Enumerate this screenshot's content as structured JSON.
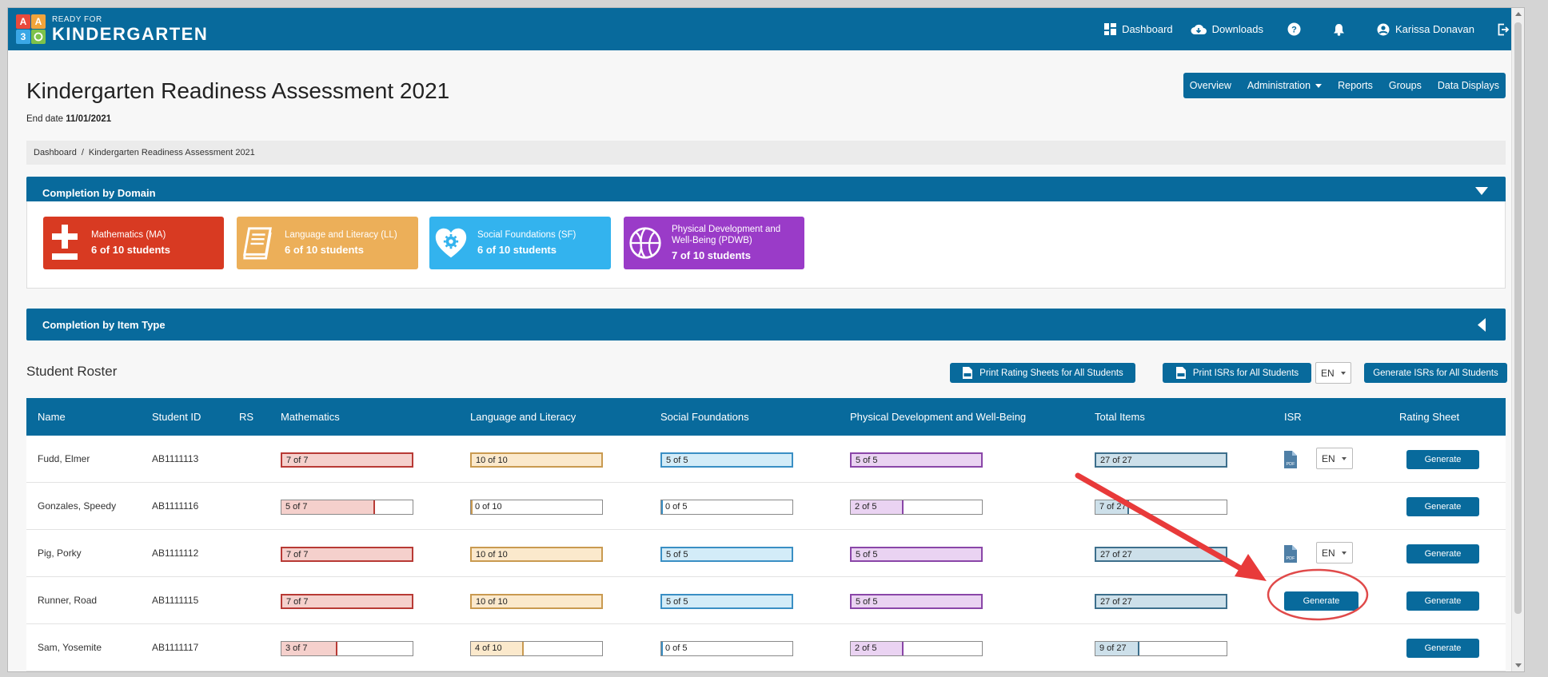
{
  "app": {
    "logo_small": "READY FOR",
    "logo_big": "KINDERGARTEN",
    "logo_blocks": [
      "A",
      "A",
      "3",
      ""
    ]
  },
  "topnav": {
    "dashboard": "Dashboard",
    "downloads": "Downloads",
    "user": "Karissa Donavan"
  },
  "page": {
    "title": "Kindergarten Readiness Assessment 2021",
    "end_date_label": "End date",
    "end_date_value": "11/01/2021"
  },
  "subnav": {
    "items": [
      "Overview",
      "Administration",
      "Reports",
      "Groups",
      "Data Displays"
    ]
  },
  "breadcrumb": {
    "items": [
      "Dashboard",
      "/",
      "Kindergarten Readiness Assessment 2021"
    ]
  },
  "sections": {
    "domain_title": "Completion by Domain",
    "item_type_title": "Completion by Item Type"
  },
  "domains": [
    {
      "name": "Mathematics (MA)",
      "count": "6 of 10 students",
      "color": "#d83a22",
      "icon": "plus-minus-icon"
    },
    {
      "name": "Language and Literacy (LL)",
      "count": "6 of 10 students",
      "color": "#ecaf59",
      "icon": "book-icon"
    },
    {
      "name": "Social Foundations (SF)",
      "count": "6 of 10 students",
      "color": "#33b3ee",
      "icon": "heart-gear-icon"
    },
    {
      "name": "Physical Development and Well-Being (PDWB)",
      "name_line1": "Physical Development and",
      "name_line2": "Well-Being (PDWB)",
      "count": "7 of 10 students",
      "color": "#9a3bc8",
      "icon": "ball-icon"
    }
  ],
  "roster": {
    "title": "Student Roster",
    "print_rating_sheets": "Print Rating Sheets for All Students",
    "print_isrs": "Print ISRs for All Students",
    "language": "EN",
    "generate_isrs": "Generate ISRs for All Students"
  },
  "table": {
    "headers": [
      "Name",
      "Student ID",
      "RS",
      "Mathematics",
      "Language and Literacy",
      "Social Foundations",
      "Physical Development and Well-Being",
      "Total Items",
      "ISR",
      "Rating Sheet"
    ],
    "generate_label": "Generate",
    "lang_label": "EN",
    "colors": {
      "math_fill": "#f5d0cc",
      "math_border": "#b83a35",
      "ll_fill": "#fbe9cc",
      "ll_border": "#c99a50",
      "sf_fill": "#d3ecf8",
      "sf_border": "#3a8fc4",
      "pd_fill": "#ead3f2",
      "pd_border": "#8a46a8",
      "total_fill": "#cde0ea",
      "total_border": "#3d6f8c"
    },
    "rows": [
      {
        "name": "Fudd, Elmer",
        "id": "AB1111113",
        "rs": "",
        "math": "7 of 7",
        "math_frac": 1.0,
        "ll": "10 of 10",
        "ll_frac": 1.0,
        "sf": "5 of 5",
        "sf_frac": 1.0,
        "pd": "5 of 5",
        "pd_frac": 1.0,
        "total": "27 of 27",
        "total_frac": 1.0,
        "isr": "pdf"
      },
      {
        "name": "Gonzales, Speedy",
        "id": "AB1111116",
        "rs": "",
        "math": "5 of 7",
        "math_frac": 0.714,
        "ll": "0 of 10",
        "ll_frac": 0.0,
        "sf": "0 of 5",
        "sf_frac": 0.0,
        "pd": "2 of 5",
        "pd_frac": 0.4,
        "total": "7 of 27",
        "total_frac": 0.259,
        "isr": "none"
      },
      {
        "name": "Pig, Porky",
        "id": "AB1111112",
        "rs": "",
        "math": "7 of 7",
        "math_frac": 1.0,
        "ll": "10 of 10",
        "ll_frac": 1.0,
        "sf": "5 of 5",
        "sf_frac": 1.0,
        "pd": "5 of 5",
        "pd_frac": 1.0,
        "total": "27 of 27",
        "total_frac": 1.0,
        "isr": "pdf"
      },
      {
        "name": "Runner, Road",
        "id": "AB1111115",
        "rs": "",
        "math": "7 of 7",
        "math_frac": 1.0,
        "ll": "10 of 10",
        "ll_frac": 1.0,
        "sf": "5 of 5",
        "sf_frac": 1.0,
        "pd": "5 of 5",
        "pd_frac": 1.0,
        "total": "27 of 27",
        "total_frac": 1.0,
        "isr": "generate"
      },
      {
        "name": "Sam, Yosemite",
        "id": "AB1111117",
        "rs": "",
        "math": "3 of 7",
        "math_frac": 0.429,
        "ll": "4 of 10",
        "ll_frac": 0.4,
        "sf": "0 of 5",
        "sf_frac": 0.0,
        "pd": "2 of 5",
        "pd_frac": 0.4,
        "total": "9 of 27",
        "total_frac": 0.333,
        "isr": "none"
      }
    ]
  },
  "annotation": {
    "arrow_color": "#e83a3a",
    "circle_color": "#e04a4a"
  }
}
